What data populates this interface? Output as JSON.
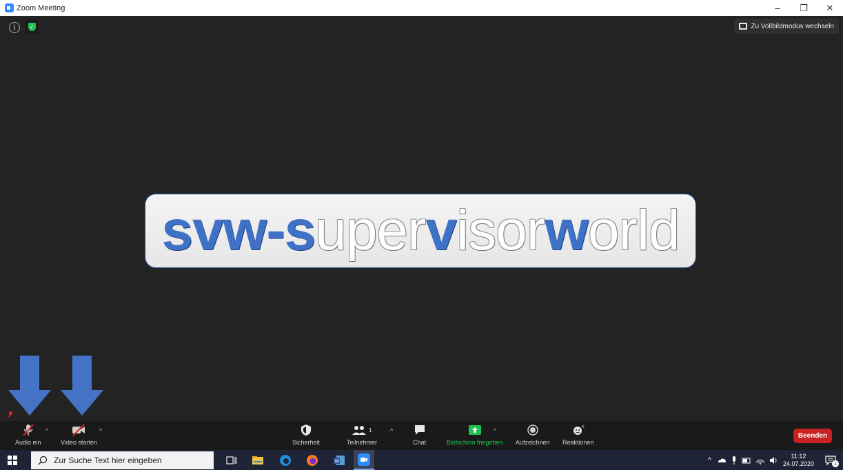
{
  "window": {
    "title": "Zoom Meeting",
    "minimize": "–",
    "restore": "❐",
    "close": "✕"
  },
  "meeting": {
    "info_glyph": "i",
    "shield_glyph": "✓",
    "fullscreen_label": "Zu Vollbildmodus wechseln",
    "banner": {
      "parts": [
        "svw-s",
        "uper",
        "v",
        "isor ",
        "w",
        "orld"
      ]
    }
  },
  "toolbar": {
    "audio": "Audio ein",
    "video": "Video starten",
    "security": "Sicherheit",
    "participants": "Teilnehmer",
    "participants_count": "1",
    "chat": "Chat",
    "share": "Bildschirm freigeben",
    "record": "Aufzeichnen",
    "reactions": "Reaktionen",
    "end": "Beenden",
    "caret": "^"
  },
  "taskbar": {
    "search_placeholder": "Zur Suche Text hier eingeben",
    "time": "11:12",
    "date": "24.07.2020",
    "tray_caret": "^",
    "notif_count": "1"
  },
  "colors": {
    "accent_blue": "#3f72c7",
    "share_green": "#1ec451",
    "end_red": "#c92020"
  }
}
